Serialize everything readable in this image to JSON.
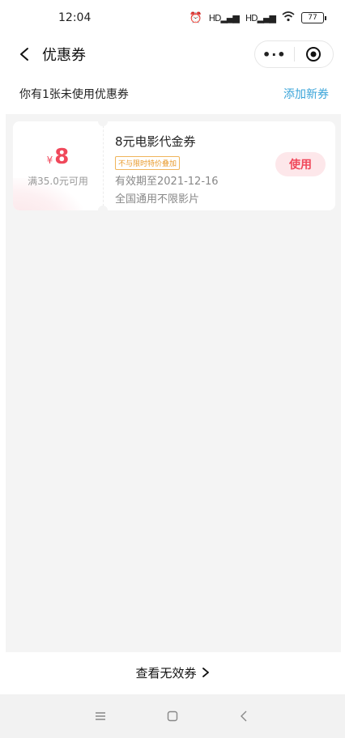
{
  "status_bar": {
    "time": "12:04",
    "signal_1": "HD",
    "signal_2": "HD",
    "battery": "77"
  },
  "nav": {
    "title": "优惠券"
  },
  "summary": {
    "text": "你有1张未使用优惠券",
    "add_label": "添加新券"
  },
  "coupon": {
    "currency": "¥",
    "amount": "8",
    "min_spend": "满35.0元可用",
    "name": "8元电影代金券",
    "tag": "不与限时特价叠加",
    "validity": "有效期至2021-12-16",
    "scope": "全国通用不限影片",
    "use_label": "使用"
  },
  "footer": {
    "view_invalid_label": "查看无效券"
  },
  "colors": {
    "accent_red": "#f0485b",
    "link_blue": "#3aa4d9",
    "tag_orange": "#e89a2c"
  }
}
